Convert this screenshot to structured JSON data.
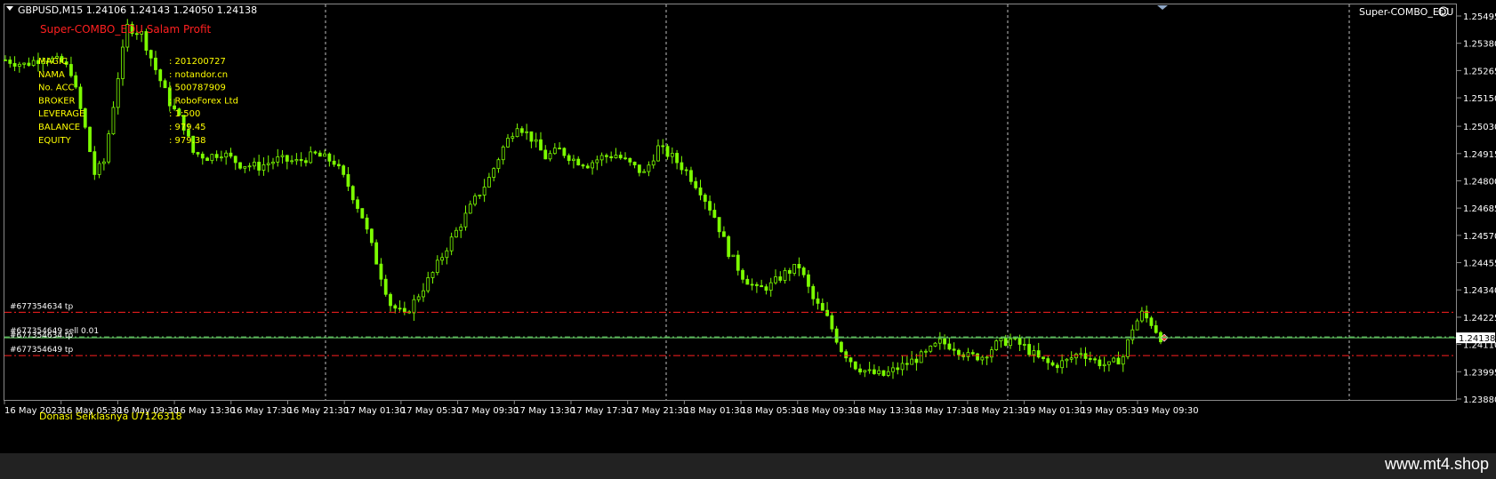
{
  "header": {
    "symbol_info": "GBPUSD,M15  1.24106 1.24143 1.24050 1.24138",
    "indicator_name": "Super-COMBO_EDU",
    "indicator_icon": "smiley-icon"
  },
  "ea_panel": {
    "title": "Super-COMBO_EDU Salam Profit",
    "rows": [
      {
        "label": "MAGIC",
        "value": ": 201200727"
      },
      {
        "label": "NAMA",
        "value": ": notandor.cn"
      },
      {
        "label": "No. ACC",
        "value": ": 500787909"
      },
      {
        "label": "BROKER",
        "value": ": RoboForex Ltd"
      },
      {
        "label": "LEVERAGE",
        "value": ": 1:500"
      },
      {
        "label": "BALANCE",
        "value": ": 979.45"
      },
      {
        "label": "EQUITY",
        "value": ": 979.38"
      }
    ],
    "donation": "Donasi Seiklasnya U7126318"
  },
  "order_lines": [
    {
      "label": "#677354634 tp",
      "price": 1.24246
    },
    {
      "label": "#677354649 sell 0.01",
      "price": 1.24142
    },
    {
      "label": "#677354649 tp",
      "price": 1.24063
    }
  ],
  "price_axis": {
    "ticks": [
      "1.25495",
      "1.25380",
      "1.25265",
      "1.25150",
      "1.25030",
      "1.24915",
      "1.24800",
      "1.24685",
      "1.24570",
      "1.24455",
      "1.24340",
      "1.24225",
      "1.24110",
      "1.23995",
      "1.23880"
    ],
    "current_price_label": "1.24138",
    "current_price": 1.24138
  },
  "time_axis": {
    "ticks": [
      "16 May 2023",
      "16 May 05:30",
      "16 May 09:30",
      "16 May 13:30",
      "16 May 17:30",
      "16 May 21:30",
      "17 May 01:30",
      "17 May 05:30",
      "17 May 09:30",
      "17 May 13:30",
      "17 May 17:30",
      "17 May 21:30",
      "18 May 01:30",
      "18 May 05:30",
      "18 May 09:30",
      "18 May 13:30",
      "18 May 17:30",
      "18 May 21:30",
      "19 May 01:30",
      "19 May 05:30",
      "19 May 09:30"
    ]
  },
  "colors": {
    "background": "#000000",
    "candle": "#7CFC00",
    "grid_separator": "#c0c0c0",
    "order_line": "#ff2020",
    "bid_line": "#66cc66",
    "panel_title": "#ff2020",
    "panel_text": "#ffff00",
    "axis_text": "#ffffff"
  },
  "watermark": "www.mt4.shop",
  "chart_data": {
    "type": "candlestick",
    "symbol": "GBPUSD",
    "timeframe": "M15",
    "ylim": [
      1.23855,
      1.2558
    ],
    "close_path": [
      [
        0,
        1.2531
      ],
      [
        4,
        1.2529
      ],
      [
        8,
        1.2532
      ],
      [
        12,
        1.253
      ],
      [
        14,
        1.2526
      ],
      [
        17,
        1.2502
      ],
      [
        19,
        1.2483
      ],
      [
        21,
        1.2488
      ],
      [
        24,
        1.2524
      ],
      [
        26,
        1.2545
      ],
      [
        29,
        1.2542
      ],
      [
        32,
        1.2527
      ],
      [
        35,
        1.2513
      ],
      [
        38,
        1.2503
      ],
      [
        40,
        1.2492
      ],
      [
        43,
        1.249
      ],
      [
        46,
        1.2492
      ],
      [
        50,
        1.2487
      ],
      [
        54,
        1.2486
      ],
      [
        58,
        1.2489
      ],
      [
        62,
        1.2488
      ],
      [
        66,
        1.2491
      ],
      [
        70,
        1.2488
      ],
      [
        73,
        1.2478
      ],
      [
        76,
        1.2465
      ],
      [
        79,
        1.2446
      ],
      [
        82,
        1.2428
      ],
      [
        85,
        1.2423
      ],
      [
        88,
        1.2432
      ],
      [
        91,
        1.2441
      ],
      [
        94,
        1.2452
      ],
      [
        97,
        1.2462
      ],
      [
        100,
        1.2472
      ],
      [
        103,
        1.2481
      ],
      [
        106,
        1.2494
      ],
      [
        109,
        1.2504
      ],
      [
        112,
        1.2498
      ],
      [
        115,
        1.249
      ],
      [
        118,
        1.2493
      ],
      [
        121,
        1.2489
      ],
      [
        124,
        1.2487
      ],
      [
        127,
        1.249
      ],
      [
        130,
        1.2491
      ],
      [
        133,
        1.2487
      ],
      [
        136,
        1.2483
      ],
      [
        139,
        1.2494
      ],
      [
        142,
        1.249
      ],
      [
        145,
        1.2484
      ],
      [
        148,
        1.2476
      ],
      [
        151,
        1.2465
      ],
      [
        154,
        1.245
      ],
      [
        157,
        1.244
      ],
      [
        160,
        1.2434
      ],
      [
        163,
        1.2436
      ],
      [
        166,
        1.2441
      ],
      [
        169,
        1.2444
      ],
      [
        172,
        1.243
      ],
      [
        175,
        1.2422
      ],
      [
        178,
        1.2409
      ],
      [
        181,
        1.2402
      ],
      [
        184,
        1.2399
      ],
      [
        187,
        1.2398
      ],
      [
        190,
        1.2401
      ],
      [
        193,
        1.2404
      ],
      [
        196,
        1.2407
      ],
      [
        199,
        1.2412
      ],
      [
        202,
        1.241
      ],
      [
        205,
        1.2406
      ],
      [
        208,
        1.2406
      ],
      [
        211,
        1.2411
      ],
      [
        214,
        1.2413
      ],
      [
        217,
        1.241
      ],
      [
        220,
        1.2405
      ],
      [
        223,
        1.2402
      ],
      [
        226,
        1.2404
      ],
      [
        229,
        1.2408
      ],
      [
        232,
        1.2404
      ],
      [
        235,
        1.2402
      ],
      [
        238,
        1.2406
      ],
      [
        240,
        1.2418
      ],
      [
        242,
        1.2424
      ],
      [
        244,
        1.242
      ],
      [
        246,
        1.2414
      ]
    ]
  }
}
